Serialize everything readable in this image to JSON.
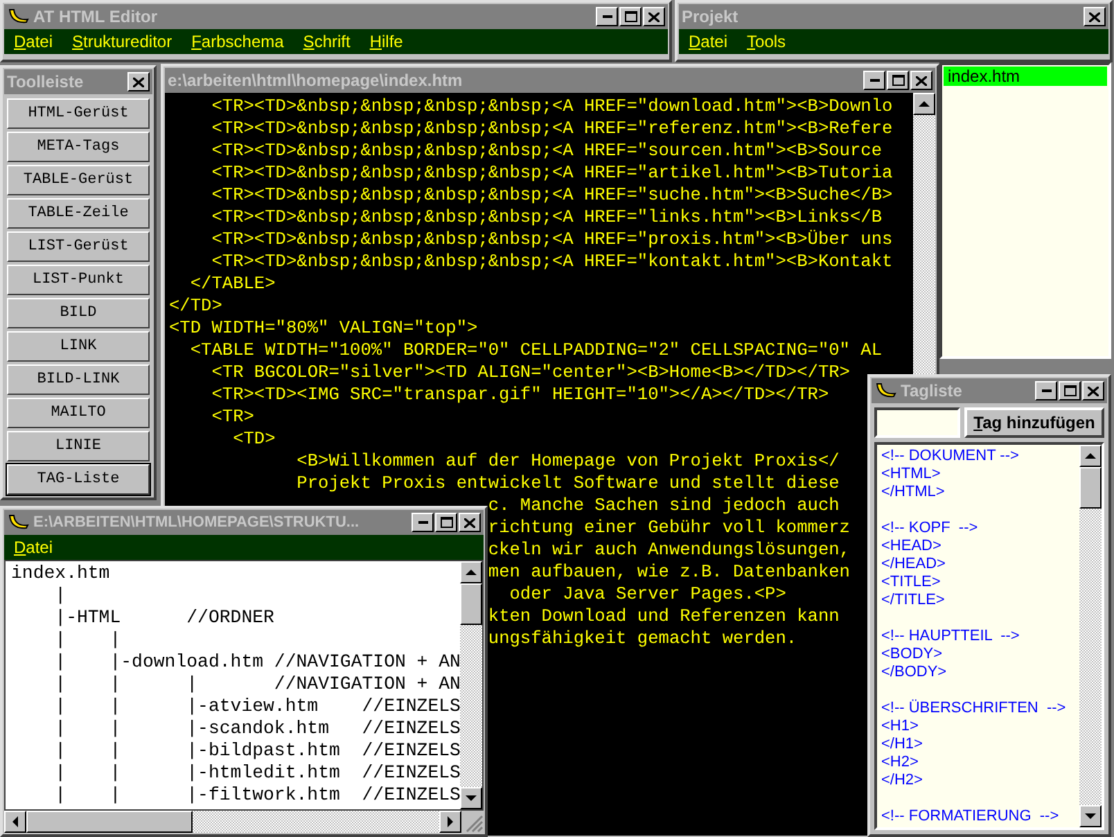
{
  "main_window": {
    "title": "AT HTML Editor",
    "menu": [
      "Datei",
      "Struktureditor",
      "Farbschema",
      "Schrift",
      "Hilfe"
    ]
  },
  "project_window": {
    "title": "Projekt",
    "menu": [
      "Datei",
      "Tools"
    ],
    "files": [
      {
        "name": "index.htm",
        "selected": true
      }
    ]
  },
  "toolbar_window": {
    "title": "Toolleiste",
    "buttons": [
      {
        "label": "HTML-Gerüst",
        "focused": false
      },
      {
        "label": "META-Tags",
        "focused": false
      },
      {
        "label": "TABLE-Gerüst",
        "focused": false
      },
      {
        "label": "TABLE-Zeile",
        "focused": false
      },
      {
        "label": "LIST-Gerüst",
        "focused": false
      },
      {
        "label": "LIST-Punkt",
        "focused": false
      },
      {
        "label": "BILD",
        "focused": false
      },
      {
        "label": "LINK",
        "focused": false
      },
      {
        "label": "BILD-LINK",
        "focused": false
      },
      {
        "label": "MAILTO",
        "focused": false
      },
      {
        "label": "LINIE",
        "focused": false
      },
      {
        "label": "TAG-Liste",
        "focused": true
      }
    ]
  },
  "editor_window": {
    "title": "e:\\arbeiten\\html\\homepage\\index.htm",
    "lines": [
      "    <TR><TD>&nbsp;&nbsp;&nbsp;&nbsp;<A HREF=\"download.htm\"><B>Downlo",
      "    <TR><TD>&nbsp;&nbsp;&nbsp;&nbsp;<A HREF=\"referenz.htm\"><B>Refere",
      "    <TR><TD>&nbsp;&nbsp;&nbsp;&nbsp;<A HREF=\"sourcen.htm\"><B>Source",
      "    <TR><TD>&nbsp;&nbsp;&nbsp;&nbsp;<A HREF=\"artikel.htm\"><B>Tutoria",
      "    <TR><TD>&nbsp;&nbsp;&nbsp;&nbsp;<A HREF=\"suche.htm\"><B>Suche</B>",
      "    <TR><TD>&nbsp;&nbsp;&nbsp;&nbsp;<A HREF=\"links.htm\"><B>Links</B",
      "    <TR><TD>&nbsp;&nbsp;&nbsp;&nbsp;<A HREF=\"proxis.htm\"><B>Über uns",
      "    <TR><TD>&nbsp;&nbsp;&nbsp;&nbsp;<A HREF=\"kontakt.htm\"><B>Kontakt",
      "  </TABLE>",
      "</TD>",
      "<TD WIDTH=\"80%\" VALIGN=\"top\">",
      "  <TABLE WIDTH=\"100%\" BORDER=\"0\" CELLPADDING=\"2\" CELLSPACING=\"0\" AL",
      "    <TR BGCOLOR=\"silver\"><TD ALIGN=\"center\"><B>Home<B></TD></TR>",
      "    <TR><TD><IMG SRC=\"transpar.gif\" HEIGHT=\"10\"></A></TD></TR>",
      "    <TR>",
      "      <TD>",
      "            <B>Willkommen auf der Homepage von Projekt Proxis</",
      "            Projekt Proxis entwickelt Software und stellt diese",
      "                              c. Manche Sachen sind jedoch auch",
      "                              richtung einer Gebühr voll kommerz",
      "                              ckeln wir auch Anwendungslösungen,",
      "                              men aufbauen, wie z.B. Datenbanken",
      "                                oder Java Server Pages.<P>",
      "                              kten Download und Referenzen kann",
      "                              ungsfähigkeit gemacht werden."
    ]
  },
  "structure_window": {
    "title": "E:\\ARBEITEN\\HTML\\HOMEPAGE\\STRUKTU...",
    "menu": [
      "Datei"
    ],
    "lines": [
      "index.htm",
      "    |",
      "    |-HTML      //ORDNER",
      "    |    |",
      "    |    |-download.htm //NAVIGATION + AN",
      "    |    |      |       //NAVIGATION + AN",
      "    |    |      |-atview.htm    //EINZELS",
      "    |    |      |-scandok.htm   //EINZELS",
      "    |    |      |-bildpast.htm  //EINZELS",
      "    |    |      |-htmledit.htm  //EINZELS",
      "    |    |      |-filtwork.htm  //EINZELS"
    ]
  },
  "tag_window": {
    "title": "Tagliste",
    "add_button": "Tag hinzufügen",
    "groups": [
      [
        "<!-- DOKUMENT -->",
        "<HTML>",
        "</HTML>"
      ],
      [
        "<!-- KOPF  -->",
        "<HEAD>",
        "</HEAD>",
        "<TITLE>",
        "</TITLE>"
      ],
      [
        "<!-- HAUPTTEIL  -->",
        "<BODY>",
        "</BODY>"
      ],
      [
        "<!-- ÜBERSCHRIFTEN  -->",
        "<H1>",
        "</H1>",
        "<H2>",
        "</H2>"
      ],
      [
        "<!-- FORMATIERUNG  -->"
      ]
    ]
  }
}
